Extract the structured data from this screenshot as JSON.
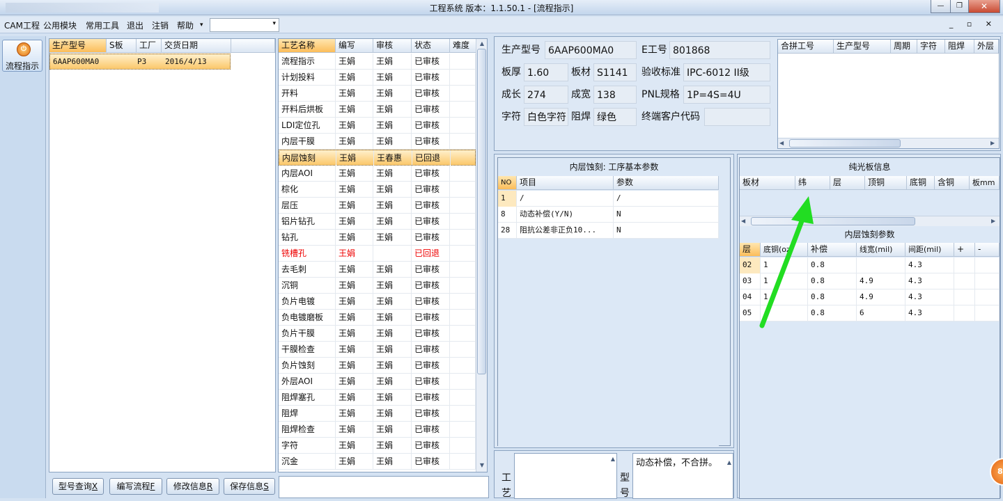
{
  "window": {
    "title": "工程系统   版本：1.1.50.1 - [流程指示]",
    "minimize": "—",
    "restore": "❐",
    "close": "✕"
  },
  "menu": {
    "items": [
      "CAM工程",
      "公用模块",
      "常用工具",
      "退出",
      "注销",
      "帮助",
      "▾"
    ],
    "mdi_controls": "_ ▫ ✕"
  },
  "nav": {
    "button_label": "流程指示",
    "icon": "power-icon"
  },
  "models": {
    "headers": [
      "生产型号",
      "S板",
      "工厂",
      "交货日期"
    ],
    "rows": [
      {
        "model": "6AAP600MA0",
        "s": "",
        "factory": "P3",
        "date": "2016/4/13"
      }
    ]
  },
  "process": {
    "headers": [
      "工艺名称",
      "编写",
      "审核",
      "状态",
      "难度"
    ],
    "rows": [
      {
        "name": "流程指示",
        "writer": "王娟",
        "reviewer": "王娟",
        "status": "已审核"
      },
      {
        "name": "计划投料",
        "writer": "王娟",
        "reviewer": "王娟",
        "status": "已审核"
      },
      {
        "name": "开料",
        "writer": "王娟",
        "reviewer": "王娟",
        "status": "已审核"
      },
      {
        "name": "开料后烘板",
        "writer": "王娟",
        "reviewer": "王娟",
        "status": "已审核"
      },
      {
        "name": "LDI定位孔",
        "writer": "王娟",
        "reviewer": "王娟",
        "status": "已审核"
      },
      {
        "name": "内层干膜",
        "writer": "王娟",
        "reviewer": "王娟",
        "status": "已审核"
      },
      {
        "name": "内层蚀刻",
        "writer": "王娟",
        "reviewer": "王春惠",
        "status": "已回退",
        "selected": true
      },
      {
        "name": "内层AOI",
        "writer": "王娟",
        "reviewer": "王娟",
        "status": "已审核"
      },
      {
        "name": "棕化",
        "writer": "王娟",
        "reviewer": "王娟",
        "status": "已审核"
      },
      {
        "name": "层压",
        "writer": "王娟",
        "reviewer": "王娟",
        "status": "已审核"
      },
      {
        "name": "铝片钻孔",
        "writer": "王娟",
        "reviewer": "王娟",
        "status": "已审核"
      },
      {
        "name": "钻孔",
        "writer": "王娟",
        "reviewer": "王娟",
        "status": "已审核"
      },
      {
        "name": "铣槽孔",
        "writer": "王娟",
        "reviewer": "",
        "status": "已回退",
        "red": true
      },
      {
        "name": "去毛刺",
        "writer": "王娟",
        "reviewer": "王娟",
        "status": "已审核"
      },
      {
        "name": "沉铜",
        "writer": "王娟",
        "reviewer": "王娟",
        "status": "已审核"
      },
      {
        "name": "负片电镀",
        "writer": "王娟",
        "reviewer": "王娟",
        "status": "已审核"
      },
      {
        "name": "负电镀磨板",
        "writer": "王娟",
        "reviewer": "王娟",
        "status": "已审核"
      },
      {
        "name": "负片干膜",
        "writer": "王娟",
        "reviewer": "王娟",
        "status": "已审核"
      },
      {
        "name": "干膜检查",
        "writer": "王娟",
        "reviewer": "王娟",
        "status": "已审核"
      },
      {
        "name": "负片蚀刻",
        "writer": "王娟",
        "reviewer": "王娟",
        "status": "已审核"
      },
      {
        "name": "外层AOI",
        "writer": "王娟",
        "reviewer": "王娟",
        "status": "已审核"
      },
      {
        "name": "阻焊塞孔",
        "writer": "王娟",
        "reviewer": "王娟",
        "status": "已审核"
      },
      {
        "name": "阻焊",
        "writer": "王娟",
        "reviewer": "王娟",
        "status": "已审核"
      },
      {
        "name": "阻焊检查",
        "writer": "王娟",
        "reviewer": "王娟",
        "status": "已审核"
      },
      {
        "name": "字符",
        "writer": "王娟",
        "reviewer": "王娟",
        "status": "已审核"
      },
      {
        "name": "沉金",
        "writer": "王娟",
        "reviewer": "王娟",
        "status": "已审核"
      }
    ]
  },
  "info": {
    "model_label": "生产型号",
    "model_value": "6AAP600MA0",
    "e_label": "E工号",
    "e_value": "801868",
    "thickness_label": "板厚",
    "thickness_value": "1.60",
    "material_label": "板材",
    "material_value": "S1141",
    "standard_label": "验收标准",
    "standard_value": "IPC-6012 II级",
    "length_label": "成长",
    "length_value": "274",
    "width_label": "成宽",
    "width_value": "138",
    "pnl_label": "PNL规格",
    "pnl_value": "1P=4S=4U",
    "char_label": "字符",
    "char_value": "白色字符",
    "mask_label": "阻焊",
    "mask_value": "绿色",
    "customer_label": "终端客户代码",
    "customer_value": ""
  },
  "combine": {
    "headers": [
      "合拼工号",
      "生产型号",
      "周期",
      "字符",
      "阻焊",
      "外层"
    ]
  },
  "basic_params": {
    "title": "内层蚀刻: 工序基本参数",
    "headers": [
      "NO",
      "项目",
      "参数"
    ],
    "rows": [
      {
        "no": "1",
        "item": "/",
        "param": "/"
      },
      {
        "no": "8",
        "item": "动态补偿(Y/N)",
        "param": "N"
      },
      {
        "no": "28",
        "item": "阻抗公差非正负10...",
        "param": "N"
      }
    ]
  },
  "light_board": {
    "title": "纯光板信息",
    "headers": [
      "板材",
      "纬",
      "层",
      "顶铜",
      "底铜",
      "含铜",
      "板mm"
    ]
  },
  "etch_params": {
    "title": "内层蚀刻参数",
    "headers": [
      "层",
      "底铜(oz)",
      "补偿",
      "线宽(mil)",
      "间距(mil)",
      "+",
      "-"
    ],
    "rows": [
      {
        "layer": "02",
        "copper": "1",
        "comp": "0.8",
        "width": "",
        "space": "4.3"
      },
      {
        "layer": "03",
        "copper": "1",
        "comp": "0.8",
        "width": "4.9",
        "space": "4.3"
      },
      {
        "layer": "04",
        "copper": "1",
        "comp": "0.8",
        "width": "4.9",
        "space": "4.3"
      },
      {
        "layer": "05",
        "copper": "",
        "comp": "0.8",
        "width": "6",
        "space": "4.3"
      }
    ]
  },
  "notes": {
    "craft_label": "工艺",
    "model_label": "型号",
    "model_note": "动态补偿，不合拼。"
  },
  "buttons": {
    "query": "型号查询",
    "query_key": "X",
    "edit": "编写流程",
    "edit_key": "F",
    "modify": "修改信息",
    "modify_key": "R",
    "save": "保存信息",
    "save_key": "S"
  },
  "badge": "80",
  "colors": {
    "annotation_arrow": "#22dd22",
    "selected_row": "#fbc76a",
    "rejected_text": "#e00000"
  }
}
